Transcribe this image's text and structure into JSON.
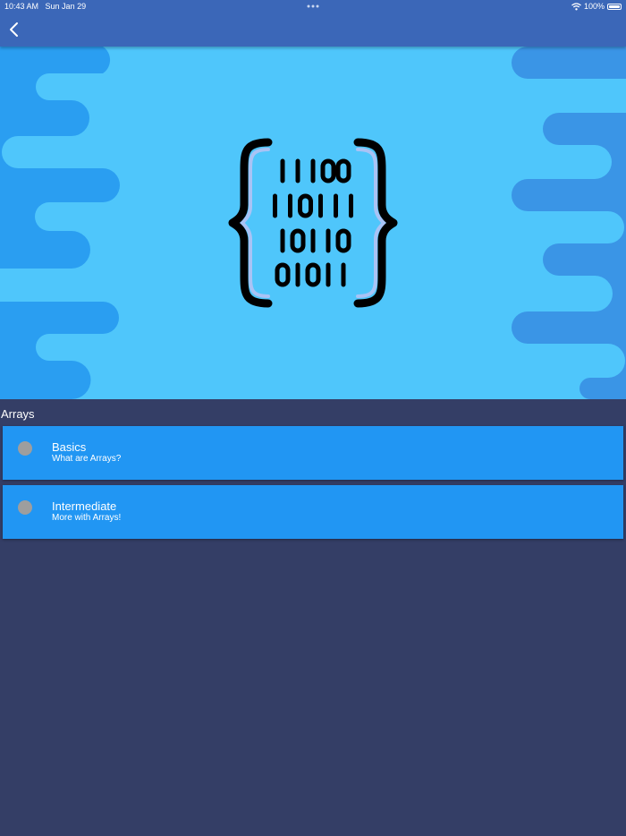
{
  "status_bar": {
    "time": "10:43 AM",
    "date": "Sun Jan 29",
    "battery_text": "100%",
    "battery_level": 1.0
  },
  "app_bar": {
    "back_icon": "chevron-left-icon"
  },
  "hero": {
    "background_color": "#4fc6fb",
    "wave_color": "#2196f3",
    "icon": "binary-code-braces-icon",
    "binary_rows": [
      "11100",
      "110111",
      "10110",
      "01011"
    ]
  },
  "section": {
    "title": "Arrays"
  },
  "lessons": [
    {
      "title": "Basics",
      "subtitle": "What are Arrays?",
      "status_color": "#9e9e9e"
    },
    {
      "title": "Intermediate",
      "subtitle": "More with Arrays!",
      "status_color": "#9e9e9e"
    }
  ],
  "colors": {
    "app_bar": "#3b67b8",
    "page_background": "#343e66",
    "card": "#2196f3"
  }
}
